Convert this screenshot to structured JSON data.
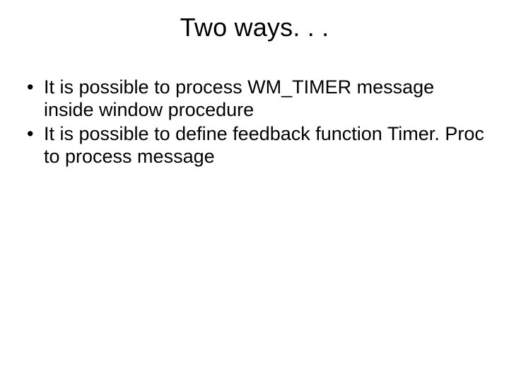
{
  "slide": {
    "title": "Two ways. . .",
    "bullets": [
      "It is possible to process WM_TIMER message inside window procedure",
      "It is possible to define feedback function Timer. Proc to process message"
    ]
  }
}
